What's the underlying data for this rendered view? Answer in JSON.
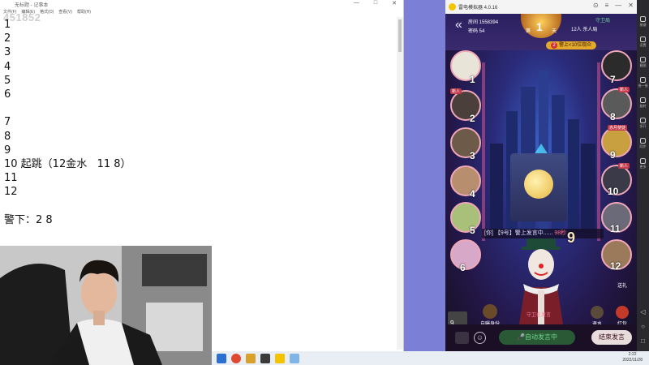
{
  "notepad": {
    "title": "无标题 - 记事本",
    "menu": [
      "文件(F)",
      "编辑(E)",
      "格式(O)",
      "查看(V)",
      "帮助(H)"
    ],
    "lines": [
      "1",
      "2",
      "3",
      "4",
      "5",
      "6",
      "",
      "7",
      "8",
      "9",
      "10 起跳（12金水   11 8）",
      "11",
      "12",
      "",
      "警下：2 8"
    ],
    "watermark": "451852"
  },
  "emulator": {
    "title": "雷电模拟器 4.0.16",
    "sidebar": [
      "按键",
      "设置",
      "截图",
      "摇一摇",
      "旋转",
      "多开",
      "同步",
      "更多"
    ]
  },
  "game": {
    "room_label": "房间 1558394",
    "password_label": "密码 54",
    "round_day": "第",
    "round_num": "1",
    "round_unit": "天",
    "mode": "守卫局",
    "players": "12人 杀人局",
    "countdown_num": "2",
    "countdown_text": "警上<10位观众",
    "speak_text": "[你] 【9号】警上发言中......",
    "speak_timer": "98秒",
    "seats": [
      {
        "num": "1",
        "tag": ""
      },
      {
        "num": "2",
        "tag": "新人"
      },
      {
        "num": "3",
        "tag": ""
      },
      {
        "num": "4",
        "tag": ""
      },
      {
        "num": "5",
        "tag": ""
      },
      {
        "num": "6",
        "tag": ""
      },
      {
        "num": "7",
        "tag": ""
      },
      {
        "num": "8",
        "tag": "新人"
      },
      {
        "num": "9",
        "tag": "赤月使徒"
      },
      {
        "num": "10",
        "tag": "新人"
      },
      {
        "num": "11",
        "tag": ""
      },
      {
        "num": "12",
        "tag": ""
      }
    ],
    "speaker_name": "守卫在发言",
    "speaker_num": "9",
    "btn_role": "自曝身份",
    "btn_exit": "退水",
    "btn_red": "红包",
    "btn_gift": "送礼",
    "bottom_seat_num": "9",
    "auto_speak": "自动发言中",
    "end_speak": "结束发言"
  },
  "taskbar": {
    "time": "2:22",
    "date": "2022/11/28"
  }
}
